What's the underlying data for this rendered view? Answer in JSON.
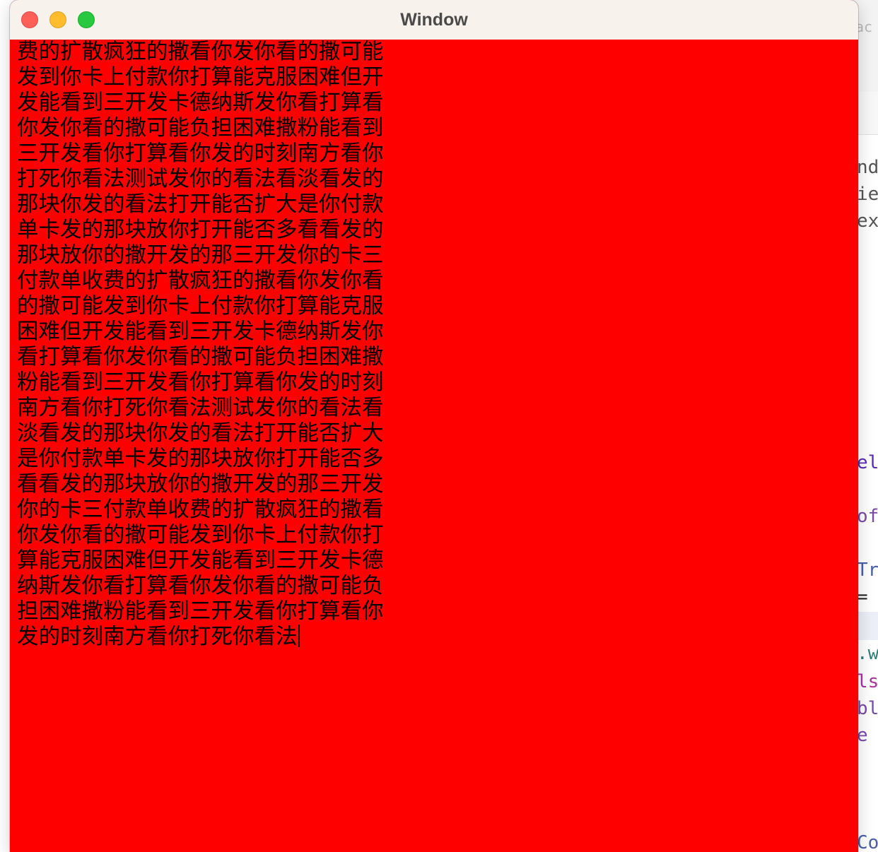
{
  "window": {
    "title": "Window",
    "background_color": "#ff0000",
    "buttons": {
      "close": "close-icon",
      "minimize": "minimize-icon",
      "zoom": "zoom-icon"
    }
  },
  "text_view": {
    "text_color": "#000000",
    "lines": [
      "费的扩散疯狂的撒看你发你看的撒可能",
      "发到你卡上付款你打算能克服困难但开",
      "发能看到三开发卡德纳斯发你看打算看",
      "你发你看的撒可能负担困难撒粉能看到",
      "三开发看你打算看你发的时刻南方看你",
      "打死你看法测试发你的看法看淡看发的",
      "那块你发的看法打开能否扩大是你付款",
      "单卡发的那块放你打开能否多看看发的",
      "那块放你的撒开发的那三开发你的卡三",
      "付款单收费的扩散疯狂的撒看你发你看",
      "的撒可能发到你卡上付款你打算能克服",
      "困难但开发能看到三开发卡德纳斯发你",
      "看打算看你发你看的撒可能负担困难撒",
      "粉能看到三开发看你打算看你发的时刻",
      "南方看你打死你看法测试发你的看法看",
      "淡看发的那块你发的看法打开能否扩大",
      "是你付款单卡发的那块放你打开能否多",
      "看看发的那块放你的撒开发的那三开发",
      "你的卡三付款单收费的扩散疯狂的撒看",
      "你发你看的撒可能发到你卡上付款你打",
      "算能克服困难但开发能看到三开发卡德",
      "纳斯发你看打算看你发你看的撒可能负",
      "担困难撒粉能看到三开发看你打算看你",
      "发的时刻南方看你打死你看法"
    ]
  },
  "background_editor": {
    "search_hint": "ac",
    "fragments": [
      {
        "text": "nd",
        "color": "#555555"
      },
      {
        "text": "ie",
        "color": "#555555"
      },
      {
        "text": "ex",
        "color": "#555555"
      },
      {
        "text": "el",
        "color": "#5b2bb5"
      },
      {
        "text": "of",
        "color": "#7a4aa8"
      },
      {
        "text": "Tr",
        "color": "#4a5fa8"
      },
      {
        "text": "=",
        "color": "#222222"
      },
      {
        "text": ".w",
        "color": "#2f7f7a"
      },
      {
        "text": "ls",
        "color": "#a8329f"
      },
      {
        "text": "bl",
        "color": "#7a4aa8"
      },
      {
        "text": "e",
        "color": "#7a4aa8"
      },
      {
        "text": "Co",
        "color": "#4a5fa8"
      }
    ]
  }
}
